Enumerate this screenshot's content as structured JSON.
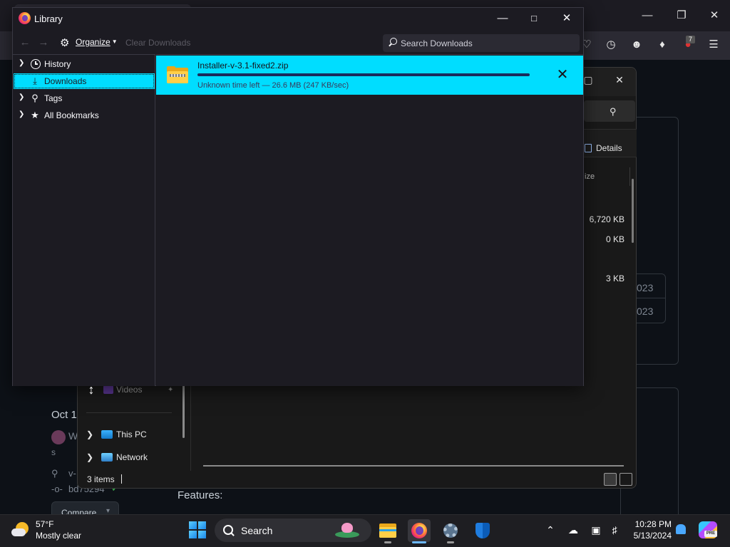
{
  "library": {
    "title": "Library",
    "toolbar": {
      "organize_label": "Organize",
      "clear_downloads_label": "Clear Downloads",
      "search_placeholder": "Search Downloads"
    },
    "sidebar": {
      "items": [
        {
          "label": "History",
          "icon": "clock-icon",
          "expandable": true
        },
        {
          "label": "Downloads",
          "icon": "download-icon",
          "selected": true
        },
        {
          "label": "Tags",
          "icon": "tag-icon",
          "expandable": true
        },
        {
          "label": "All Bookmarks",
          "icon": "star-icon",
          "expandable": true
        }
      ]
    },
    "downloads": [
      {
        "filename": "Installer-v-3.1-fixed2.zip",
        "status": "Unknown time left — 26.6 MB (247 KB/sec)",
        "progress": 1.0,
        "icon": "zip-folder-icon"
      }
    ],
    "colors": {
      "accent": "#00ddff",
      "background": "#1c1b22"
    }
  },
  "explorer": {
    "details_label": "Details",
    "size_header": "ize",
    "sizes": [
      "6,720 KB",
      "0 KB",
      "3 KB"
    ],
    "nav": {
      "videos_label": "Videos",
      "this_pc_label": "This PC",
      "network_label": "Network"
    },
    "status": "3 items"
  },
  "background_page": {
    "date_fragment": "Oct 1",
    "year_fragments": [
      "023",
      "023"
    ],
    "user_fragment": "W",
    "s_fragment": "s",
    "tag_fragment": "v-",
    "commit_hash": "bd75294",
    "compare_button": "Compare",
    "features_heading": "Features:",
    "extension_badge": "7"
  },
  "taskbar": {
    "weather": {
      "temp": "57°F",
      "description": "Mostly clear"
    },
    "search_label": "Search",
    "clock": {
      "time": "10:28 PM",
      "date": "5/13/2024"
    },
    "copilot_badge": "PRE"
  }
}
